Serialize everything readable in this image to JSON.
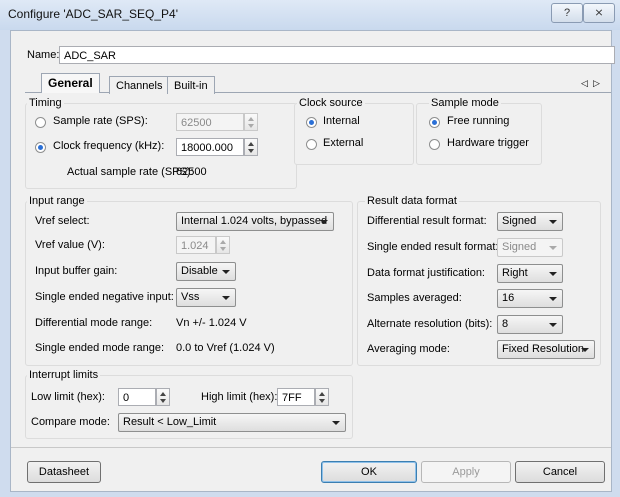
{
  "window": {
    "title": "Configure 'ADC_SAR_SEQ_P4'",
    "help_label": "?",
    "close_label": "⨯"
  },
  "name": {
    "label": "Name:",
    "value": "ADC_SAR"
  },
  "tabs": [
    {
      "label": "General",
      "active": true
    },
    {
      "label": "Channels",
      "active": false
    },
    {
      "label": "Built-in",
      "active": false
    }
  ],
  "tab_scroll": {
    "left": "◁",
    "right": "▷"
  },
  "timing": {
    "title": "Timing",
    "sample_rate_label": "Sample rate (SPS):",
    "sample_rate_value": "62500",
    "clock_freq_label": "Clock frequency (kHz):",
    "clock_freq_value": "18000.000",
    "actual_rate_label": "Actual sample rate (SPS):",
    "actual_rate_value": "62500"
  },
  "clock_source": {
    "title": "Clock source",
    "internal": "Internal",
    "external": "External"
  },
  "sample_mode": {
    "title": "Sample mode",
    "free_running": "Free running",
    "hardware_trigger": "Hardware trigger"
  },
  "input_range": {
    "title": "Input range",
    "vref_select_label": "Vref select:",
    "vref_select_value": "Internal 1.024 volts, bypassed",
    "vref_value_label": "Vref value (V):",
    "vref_value": "1.024",
    "buffer_gain_label": "Input buffer gain:",
    "buffer_gain_value": "Disable",
    "neg_input_label": "Single ended negative input:",
    "neg_input_value": "Vss",
    "diff_range_label": "Differential mode range:",
    "diff_range_value": "Vn +/- 1.024 V",
    "se_range_label": "Single ended mode range:",
    "se_range_value": "0.0 to Vref (1.024 V)"
  },
  "result_format": {
    "title": "Result data format",
    "diff_format_label": "Differential result format:",
    "diff_format_value": "Signed",
    "se_format_label": "Single ended result format:",
    "se_format_value": "Signed",
    "justification_label": "Data format justification:",
    "justification_value": "Right",
    "samples_label": "Samples averaged:",
    "samples_value": "16",
    "alt_res_label": "Alternate resolution (bits):",
    "alt_res_value": "8",
    "avg_mode_label": "Averaging mode:",
    "avg_mode_value": "Fixed Resolution"
  },
  "interrupt": {
    "title": "Interrupt limits",
    "low_label": "Low limit (hex):",
    "low_value": "0",
    "high_label": "High limit (hex):",
    "high_value": "7FF",
    "compare_label": "Compare mode:",
    "compare_value": "Result < Low_Limit"
  },
  "buttons": {
    "datasheet": "Datasheet",
    "ok": "OK",
    "apply": "Apply",
    "cancel": "Cancel"
  }
}
